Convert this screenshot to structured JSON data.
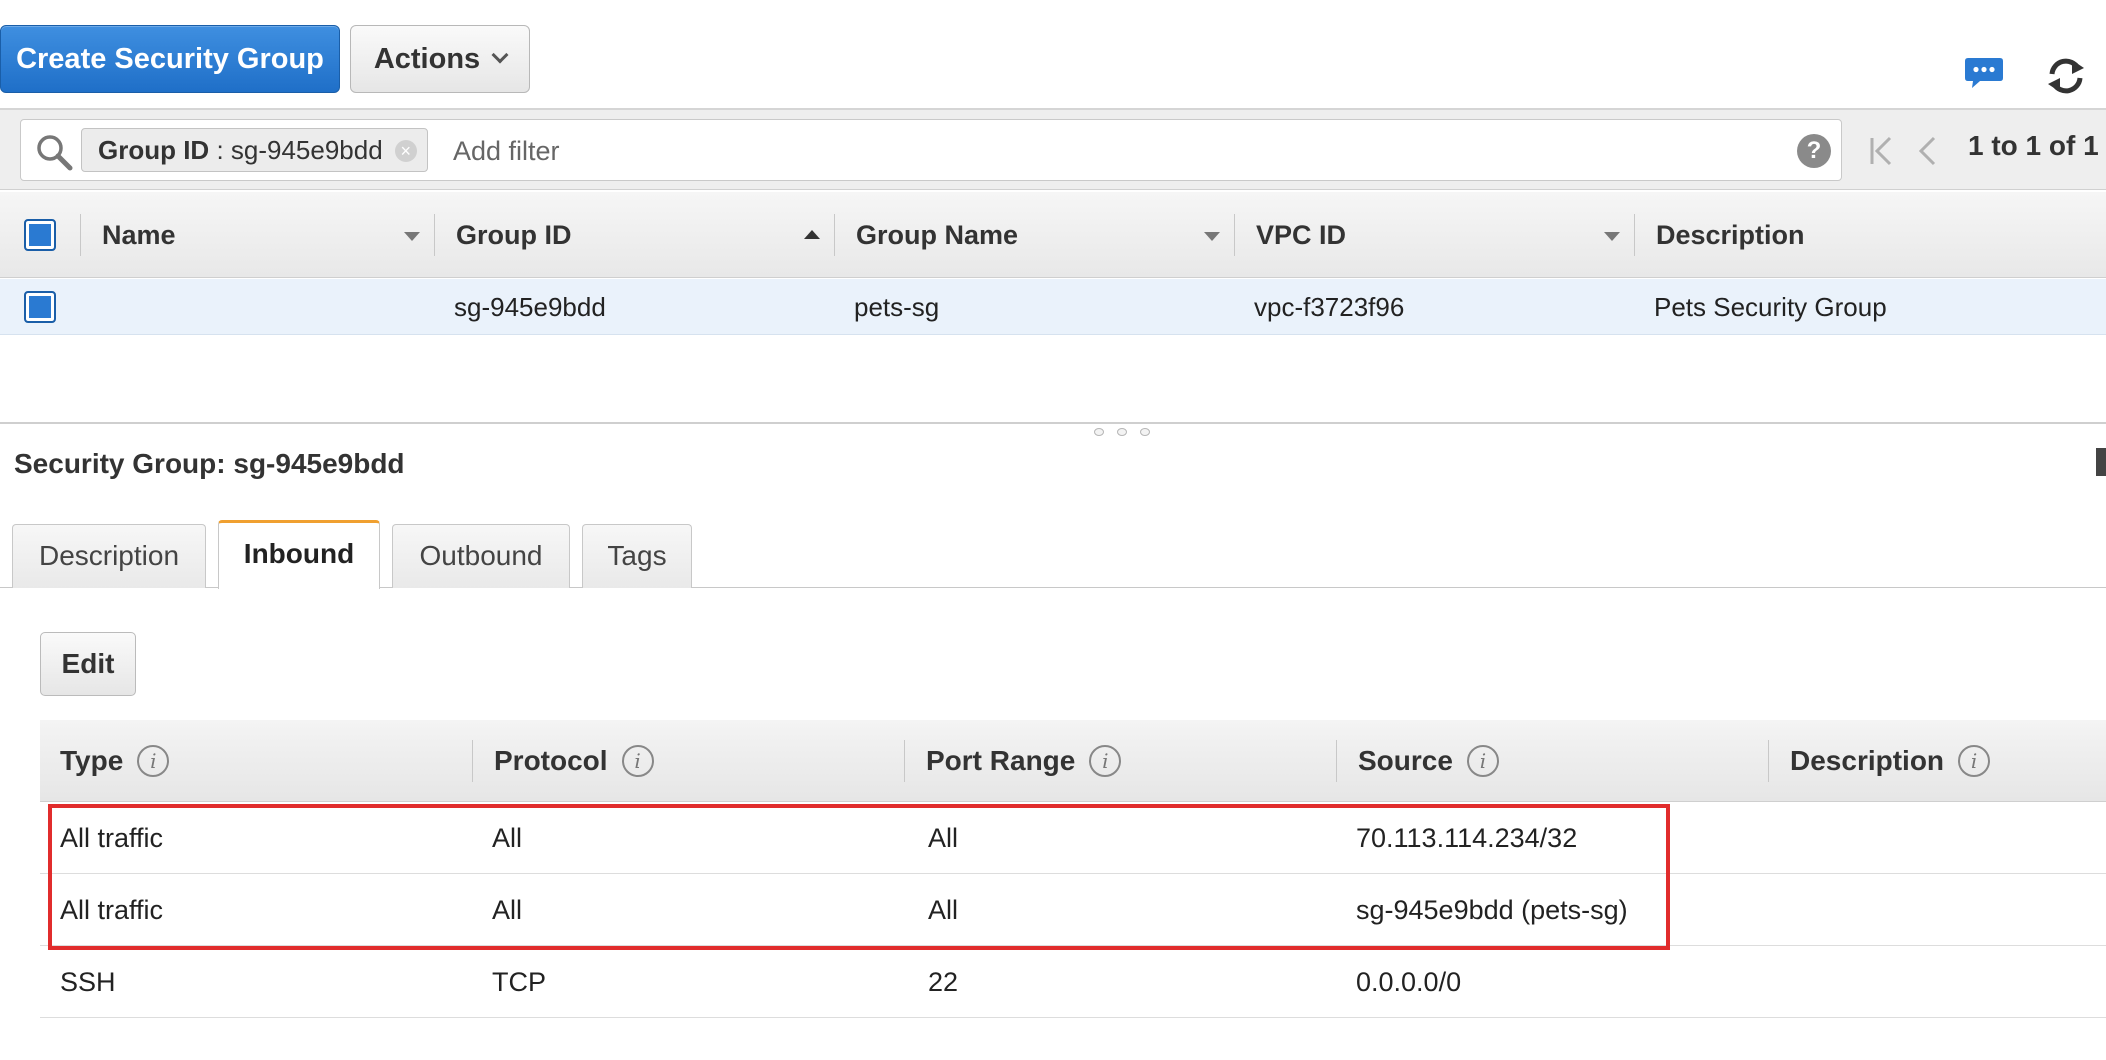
{
  "toolbar": {
    "create_label": "Create Security Group",
    "actions_label": "Actions"
  },
  "filter": {
    "token_key": "Group ID",
    "token_sep": " : ",
    "token_value": "sg-945e9bdd",
    "placeholder": "Add filter",
    "pager_text": "1 to 1 of 1"
  },
  "groups_table": {
    "columns": [
      "Name",
      "Group ID",
      "Group Name",
      "VPC ID",
      "Description"
    ],
    "rows": [
      {
        "name": "",
        "group_id": "sg-945e9bdd",
        "group_name": "pets-sg",
        "vpc_id": "vpc-f3723f96",
        "description": "Pets Security Group"
      }
    ]
  },
  "detail": {
    "title": "Security Group: sg-945e9bdd",
    "tabs": [
      "Description",
      "Inbound",
      "Outbound",
      "Tags"
    ],
    "active_tab": "Inbound",
    "edit_label": "Edit",
    "rules_columns": [
      "Type",
      "Protocol",
      "Port Range",
      "Source",
      "Description"
    ],
    "rules": [
      {
        "type": "All traffic",
        "protocol": "All",
        "port_range": "All",
        "source": "70.113.114.234/32",
        "description": ""
      },
      {
        "type": "All traffic",
        "protocol": "All",
        "port_range": "All",
        "source": "sg-945e9bdd (pets-sg)",
        "description": ""
      },
      {
        "type": "SSH",
        "protocol": "TCP",
        "port_range": "22",
        "source": "0.0.0.0/0",
        "description": ""
      }
    ]
  },
  "colors": {
    "primary_button": "#1f6fc8",
    "selected_row": "#eaf2fb",
    "active_tab_accent": "#f0a030",
    "highlight_box": "#e12c2c"
  },
  "icons": [
    "chat-icon",
    "refresh-icon",
    "search-icon",
    "clear-filter-icon",
    "help-icon",
    "first-page-icon",
    "previous-page-icon",
    "sort-caret-icon",
    "info-icon"
  ]
}
